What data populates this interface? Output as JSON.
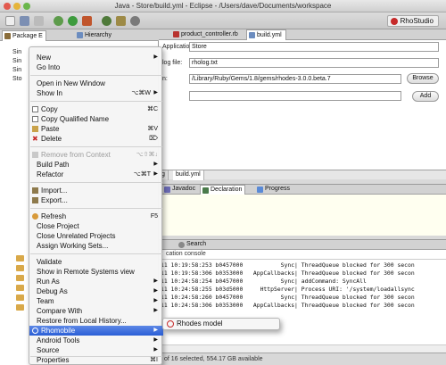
{
  "window": {
    "title": "Java - Store/build.yml - Eclipse - /Users/dave/Documents/workspace"
  },
  "toolbar": {
    "perspective_label": "RhoStudio"
  },
  "package_explorer": {
    "tabs": [
      {
        "label": "Package E"
      },
      {
        "label": "Hierarchy"
      }
    ],
    "tree": [
      "Sin",
      "Sin",
      "Sin",
      "Sto"
    ]
  },
  "editor": {
    "tabs": [
      {
        "label": "product_controller.rb"
      },
      {
        "label": "build.yml"
      }
    ],
    "fields": {
      "app_name_label": "Application name:",
      "app_name_value": "Store",
      "log_file_label": "log file:",
      "log_file_value": "rholog.txt",
      "path_label": "n:",
      "path_value": "/Library/Ruby/Gems/1.8/gems/rhodes-3.0.0.beta.7",
      "browse_label": "Browse",
      "add_label": "Add"
    },
    "bottom_tabs": [
      "g",
      "build.yml"
    ]
  },
  "middle_panel": {
    "tabs": [
      {
        "label": "Javadoc"
      },
      {
        "label": "Declaration"
      },
      {
        "label": "Progress"
      }
    ]
  },
  "console": {
    "tabs": [
      {
        "label": "Search"
      }
    ],
    "header": "cation console",
    "lines": [
      "11 10:19:58:253 b0457000           Sync| ThreadQueue blocked for 300 secon",
      "11 10:19:58:306 b0353000   AppCallbacks| ThreadQueue blocked for 300 secon",
      "11 10:24:58:254 b0457000           Sync| addCommand: SyncAll",
      "11 10:24:58:255 b03d5000     HttpServer| Process URI: '/system/loadallsync",
      "11 10:24:58:260 b0457000           Sync| ThreadQueue blocked for 300 secon",
      "11 10:24:58:306 b0353000   AppCallbacks| ThreadQueue blocked for 300 secon"
    ]
  },
  "statusbar": {
    "text": "of 16 selected, 554.17 GB available"
  },
  "context_menu": {
    "items": [
      {
        "label": "New",
        "shortcut": "",
        "submenu": true
      },
      {
        "label": "Go Into",
        "shortcut": ""
      },
      {
        "label": "Open in New Window",
        "shortcut": ""
      },
      {
        "label": "Show In",
        "shortcut": "⌥⌘W",
        "submenu": true
      },
      {
        "label": "Copy",
        "shortcut": "⌘C"
      },
      {
        "label": "Copy Qualified Name",
        "shortcut": ""
      },
      {
        "label": "Paste",
        "shortcut": "⌘V"
      },
      {
        "label": "Delete",
        "shortcut": "⌦"
      },
      {
        "label": "Remove from Context",
        "shortcut": "⌥⇧⌘↓"
      },
      {
        "label": "Build Path",
        "shortcut": "",
        "submenu": true
      },
      {
        "label": "Refactor",
        "shortcut": "⌥⌘T",
        "submenu": true
      },
      {
        "label": "Import...",
        "shortcut": ""
      },
      {
        "label": "Export...",
        "shortcut": ""
      },
      {
        "label": "Refresh",
        "shortcut": "F5"
      },
      {
        "label": "Close Project",
        "shortcut": ""
      },
      {
        "label": "Close Unrelated Projects",
        "shortcut": ""
      },
      {
        "label": "Assign Working Sets...",
        "shortcut": ""
      },
      {
        "label": "Validate",
        "shortcut": ""
      },
      {
        "label": "Show in Remote Systems view",
        "shortcut": ""
      },
      {
        "label": "Run As",
        "shortcut": "",
        "submenu": true
      },
      {
        "label": "Debug As",
        "shortcut": "",
        "submenu": true
      },
      {
        "label": "Team",
        "shortcut": "",
        "submenu": true
      },
      {
        "label": "Compare With",
        "shortcut": "",
        "submenu": true
      },
      {
        "label": "Restore from Local History...",
        "shortcut": ""
      },
      {
        "label": "Rhomobile",
        "shortcut": "",
        "submenu": true
      },
      {
        "label": "Android Tools",
        "shortcut": "",
        "submenu": true
      },
      {
        "label": "Source",
        "shortcut": "",
        "submenu": true
      },
      {
        "label": "Properties",
        "shortcut": "⌘I"
      }
    ],
    "submenu": {
      "label": "Rhodes model"
    }
  },
  "colors": {
    "highlight": "#2a5ed6",
    "accent_red": "#c62a2a"
  }
}
